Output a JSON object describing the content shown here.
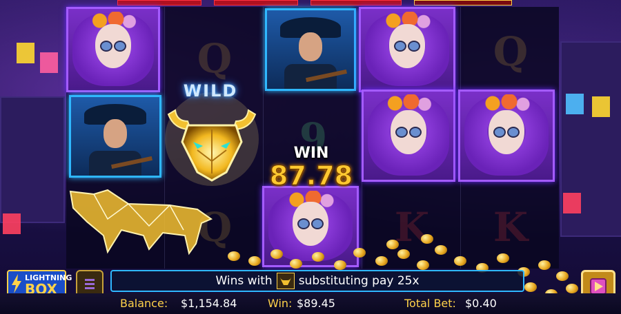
{
  "wild_label": "WILD",
  "win_popup": {
    "label": "WIN",
    "amount": "87.78"
  },
  "message": {
    "prefix": "Wins with",
    "suffix": "substituting pay 25x",
    "icon": "bull-icon"
  },
  "status": {
    "balance_label": "Balance:",
    "balance_value": "$1,154.84",
    "win_label": "Win:",
    "win_value": "$89.45",
    "bet_label": "Total Bet:",
    "bet_value": "$0.40"
  },
  "logo": {
    "line1": "LIGHTNING",
    "line2": "BOX"
  },
  "ghost_symbols": [
    "Q",
    "9",
    "Q",
    "K",
    "K",
    "Q"
  ],
  "colors": {
    "accent": "#ffc830",
    "frame": "#2fb8ff",
    "purple": "#9b5cff"
  }
}
